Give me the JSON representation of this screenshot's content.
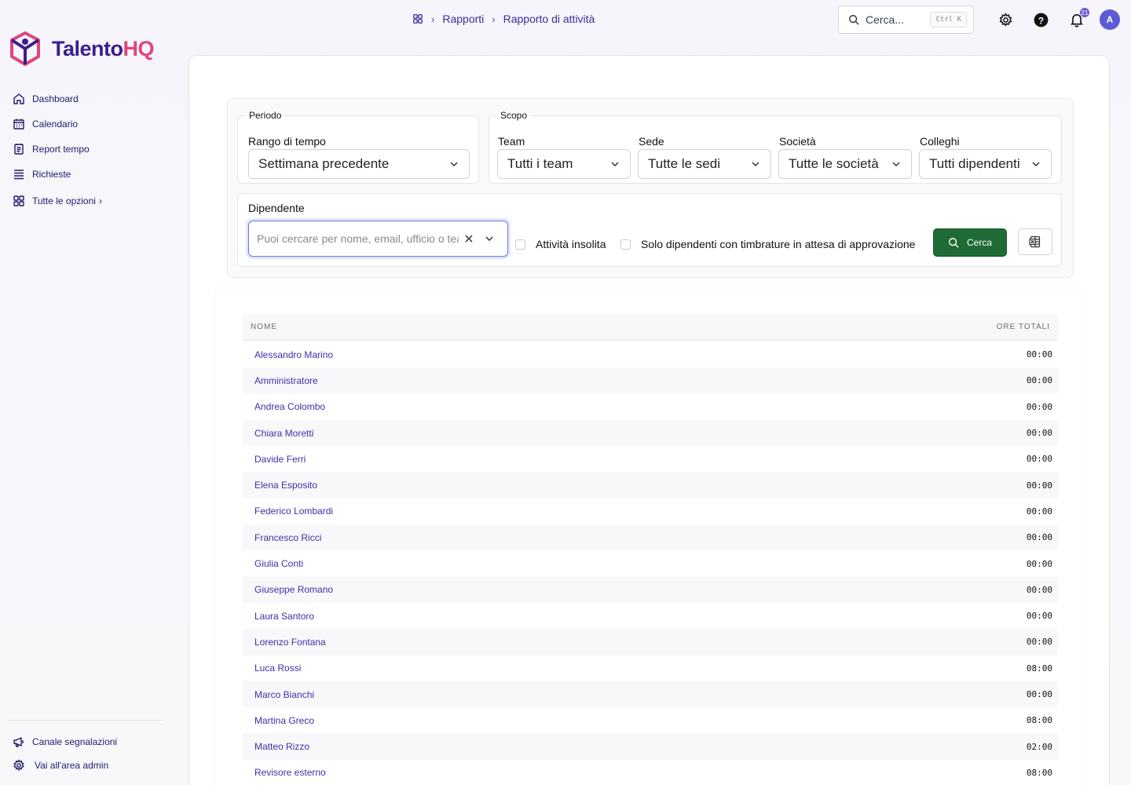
{
  "brand": {
    "name_a": "Talento",
    "name_b": "HQ"
  },
  "sidebar": {
    "items": [
      {
        "label": "Dashboard",
        "icon": "home-icon"
      },
      {
        "label": "Calendario",
        "icon": "calendar-icon"
      },
      {
        "label": "Report tempo",
        "icon": "report-icon"
      },
      {
        "label": "Richieste",
        "icon": "list-icon"
      }
    ],
    "more_label": "Tutte le opzioni",
    "bottom": [
      {
        "label": "Canale segnalazioni",
        "icon": "megaphone-icon"
      },
      {
        "label": "Vai all'area admin",
        "icon": "gear-icon"
      }
    ]
  },
  "breadcrumb": {
    "root": "Rapporti",
    "current": "Rapporto di attività"
  },
  "search": {
    "placeholder": "Cerca...",
    "shortcut": "Ctrl K"
  },
  "notifications": {
    "count": "21"
  },
  "user": {
    "initial": "A"
  },
  "filters": {
    "periodo": {
      "legend": "Periodo",
      "label": "Rango di tempo",
      "value": "Settimana precedente"
    },
    "scopo": {
      "legend": "Scopo",
      "team": {
        "label": "Team",
        "value": "Tutti i team"
      },
      "sede": {
        "label": "Sede",
        "value": "Tutte le sedi"
      },
      "societa": {
        "label": "Società",
        "value": "Tutte le società"
      },
      "colleghi": {
        "label": "Colleghi",
        "value": "Tutti dipendenti"
      }
    },
    "dipendente": {
      "label": "Dipendente",
      "placeholder": "Puoi cercare per nome, email, ufficio o team"
    },
    "chk_unusual": "Attività insolita",
    "chk_pending": "Solo dipendenti con timbrature in attesa di approvazione",
    "search_button": "Cerca"
  },
  "table": {
    "col_name": "NOME",
    "col_hours": "ORE TOTALI",
    "rows": [
      {
        "name": "Alessandro Marino",
        "hours": "00:00"
      },
      {
        "name": "Amministratore",
        "hours": "00:00"
      },
      {
        "name": "Andrea Colombo",
        "hours": "00:00"
      },
      {
        "name": "Chiara Moretti",
        "hours": "00:00"
      },
      {
        "name": "Davide Ferri",
        "hours": "00:00"
      },
      {
        "name": "Elena Esposito",
        "hours": "00:00"
      },
      {
        "name": "Federico Lombardi",
        "hours": "00:00"
      },
      {
        "name": "Francesco Ricci",
        "hours": "00:00"
      },
      {
        "name": "Giulia Conti",
        "hours": "00:00"
      },
      {
        "name": "Giuseppe Romano",
        "hours": "00:00"
      },
      {
        "name": "Laura Santoro",
        "hours": "00:00"
      },
      {
        "name": "Lorenzo Fontana",
        "hours": "00:00"
      },
      {
        "name": "Luca Rossi",
        "hours": "08:00"
      },
      {
        "name": "Marco Bianchi",
        "hours": "00:00"
      },
      {
        "name": "Martina Greco",
        "hours": "08:00"
      },
      {
        "name": "Matteo Rizzo",
        "hours": "02:00"
      },
      {
        "name": "Revisore esterno",
        "hours": "08:00"
      }
    ]
  }
}
